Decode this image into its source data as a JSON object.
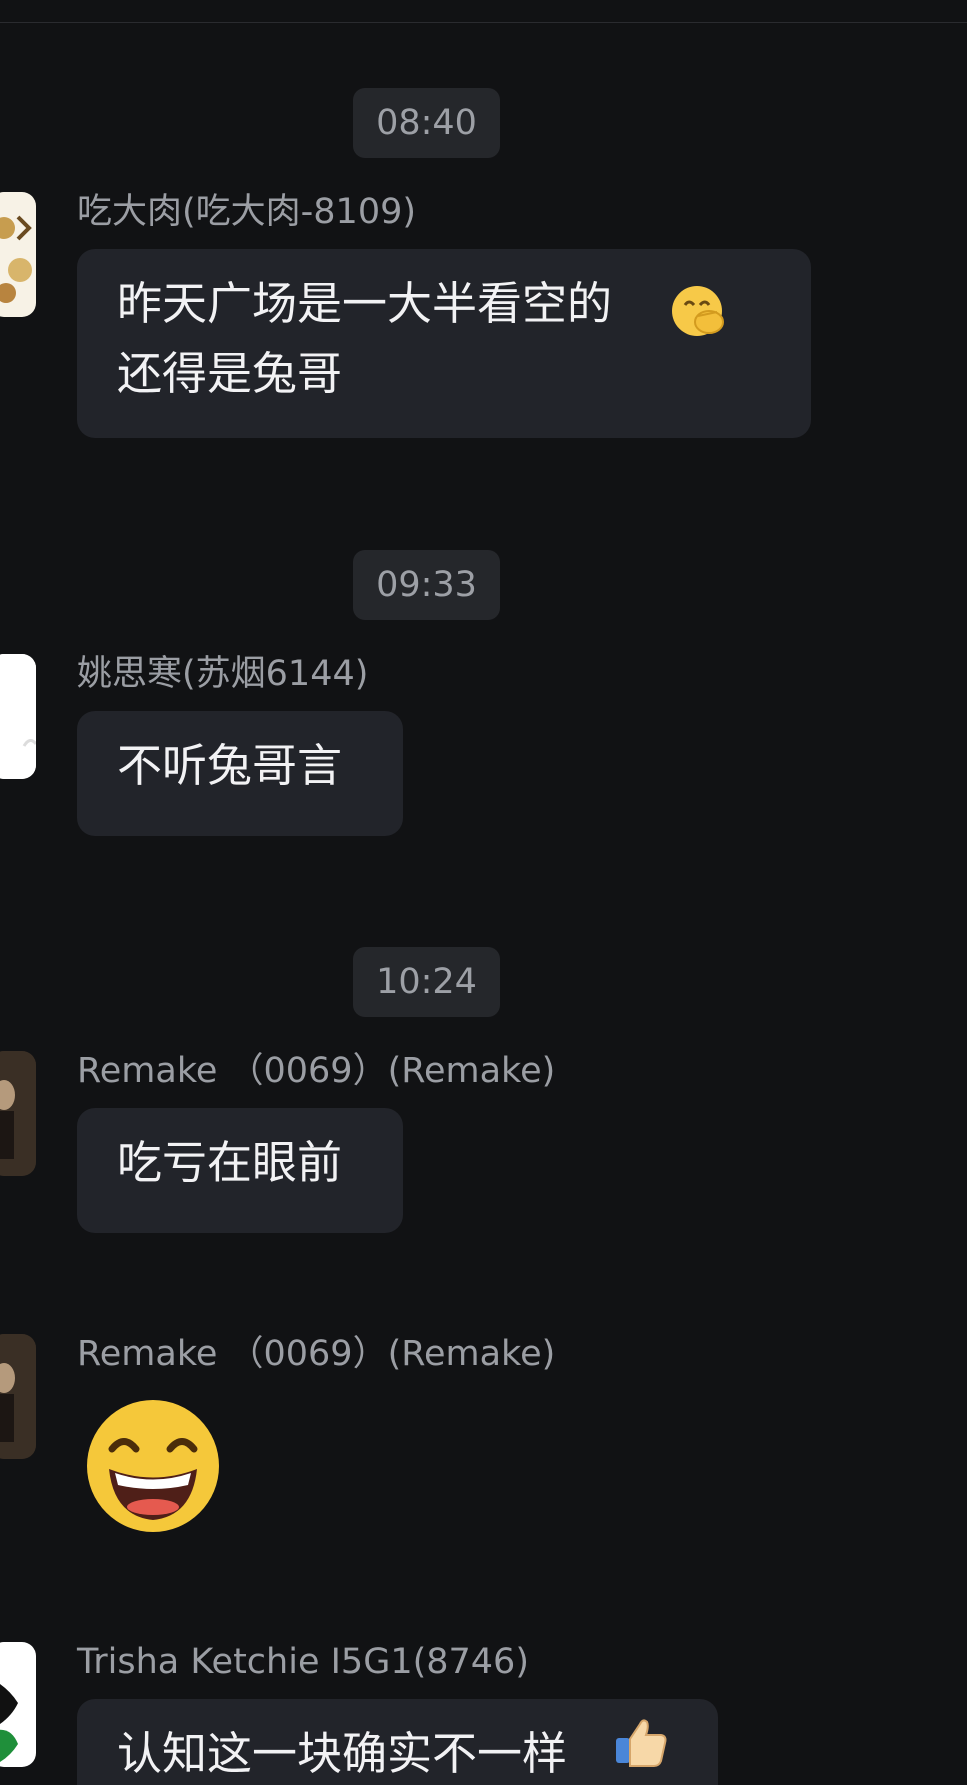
{
  "conversation": {
    "messages": [
      {
        "time": "08:40",
        "sender": "吃大肉(吃大肉-8109)",
        "text": "昨天广场是一大半看空的\n还得是兔哥",
        "emoji": "hand-over-mouth-emoji"
      },
      {
        "time": "09:33",
        "sender": "姚思寒(苏烟6144)",
        "text": "不听兔哥言"
      },
      {
        "time": "10:24",
        "sender": "Remake （0069）(Remake)",
        "text": "吃亏在眼前"
      },
      {
        "sender": "Remake （0069）(Remake)",
        "emoji": "grinning-face-emoji"
      },
      {
        "sender": "Trisha Ketchie I5G1(8746)",
        "text": "认知这一块确实不一样",
        "emoji": "thumbs-up-emoji"
      }
    ]
  },
  "colors": {
    "background": "#111214",
    "bubble": "#22242a",
    "time_pill": "#25272b",
    "sender_text": "#9b9ea4",
    "message_text": "#f2f2f4"
  }
}
